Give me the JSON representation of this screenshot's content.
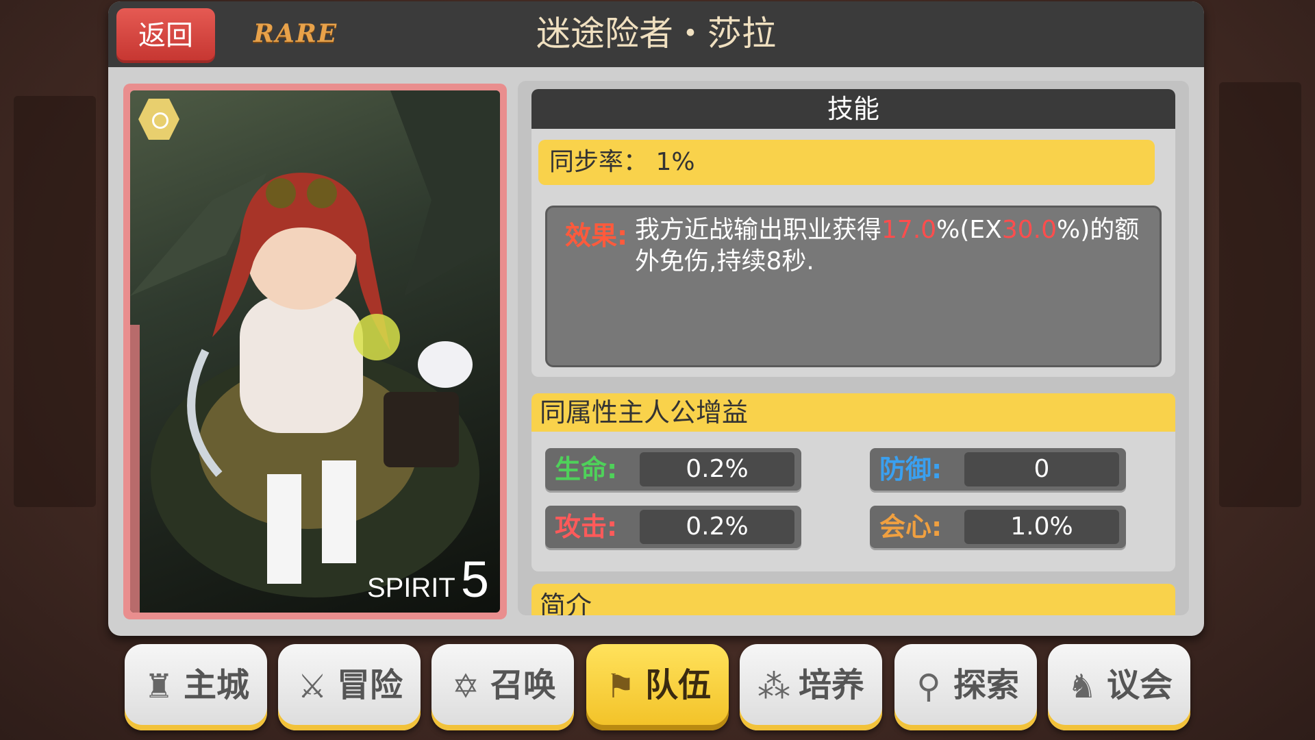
{
  "header": {
    "back_label": "返回",
    "rarity": "RARE",
    "title": "迷途险者・莎拉"
  },
  "card": {
    "spirit_label": "SPIRIT",
    "spirit_level": "5"
  },
  "skill": {
    "header": "技能",
    "sync_rate": "同步率： 1%",
    "effect_label": "效果:",
    "effect_part1": "我方近战输出职业获得",
    "effect_value1": "17.0",
    "effect_part2": "%(EX",
    "effect_value2": "30.0",
    "effect_part3": "%)的额外免伤,持续8秒."
  },
  "bonus": {
    "header": "同属性主人公增益",
    "stats": [
      {
        "label": "生命:",
        "value": "0.2%",
        "color": "#4fd15a"
      },
      {
        "label": "防御:",
        "value": "0",
        "color": "#3aa0f0"
      },
      {
        "label": "攻击:",
        "value": "0.2%",
        "color": "#ff5a5a"
      },
      {
        "label": "会心:",
        "value": "1.0%",
        "color": "#f0a040"
      }
    ]
  },
  "intro": {
    "label": "简介"
  },
  "nav": {
    "items": [
      {
        "label": "主城",
        "icon": "castle-icon"
      },
      {
        "label": "冒险",
        "icon": "crossed-swords-icon"
      },
      {
        "label": "召唤",
        "icon": "hexagram-icon"
      },
      {
        "label": "队伍",
        "icon": "team-flag-icon",
        "active": true
      },
      {
        "label": "培养",
        "icon": "three-circles-icon"
      },
      {
        "label": "探索",
        "icon": "explore-figure-icon"
      },
      {
        "label": "议会",
        "icon": "dragon-icon"
      }
    ]
  }
}
